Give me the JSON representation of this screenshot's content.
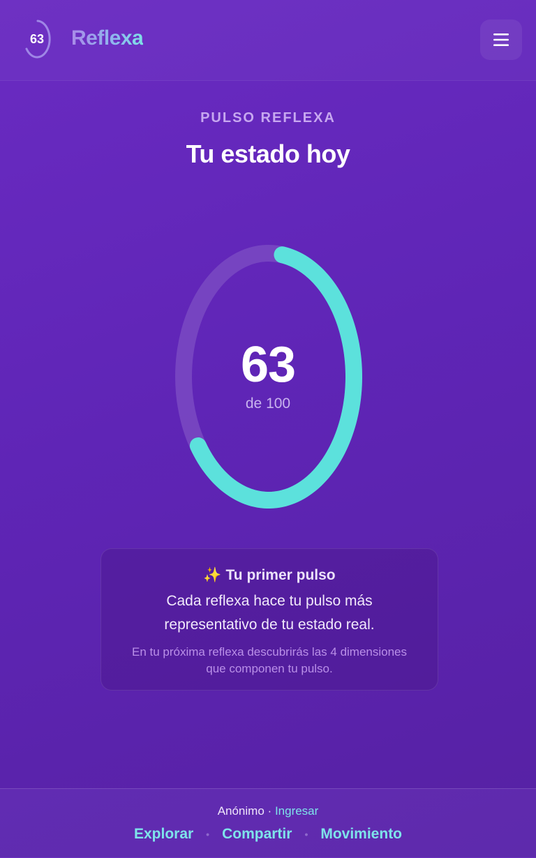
{
  "header": {
    "badge_value": "63",
    "brand": "Reflexa",
    "menu_icon": "hamburger-menu-icon"
  },
  "main": {
    "eyebrow": "PULSO REFLEXA",
    "title": "Tu estado hoy"
  },
  "score": {
    "value": "63",
    "suffix": "de 100",
    "progress": 0.63,
    "colors": {
      "ring": "#5ce1dc",
      "track": "#7e4fc4"
    }
  },
  "card": {
    "icon": "sparkles-icon",
    "sparkle": "✨",
    "title": "Tu primer pulso",
    "body": "Cada reflexa hace tu pulso más representativo de tu estado real.",
    "note": "En tu próxima reflexa descubrirás las 4 dimensiones que componen tu pulso."
  },
  "footer": {
    "user": "Anónimo",
    "separator": "·",
    "login": "Ingresar",
    "nav": [
      "Explorar",
      "Compartir",
      "Movimiento"
    ]
  }
}
